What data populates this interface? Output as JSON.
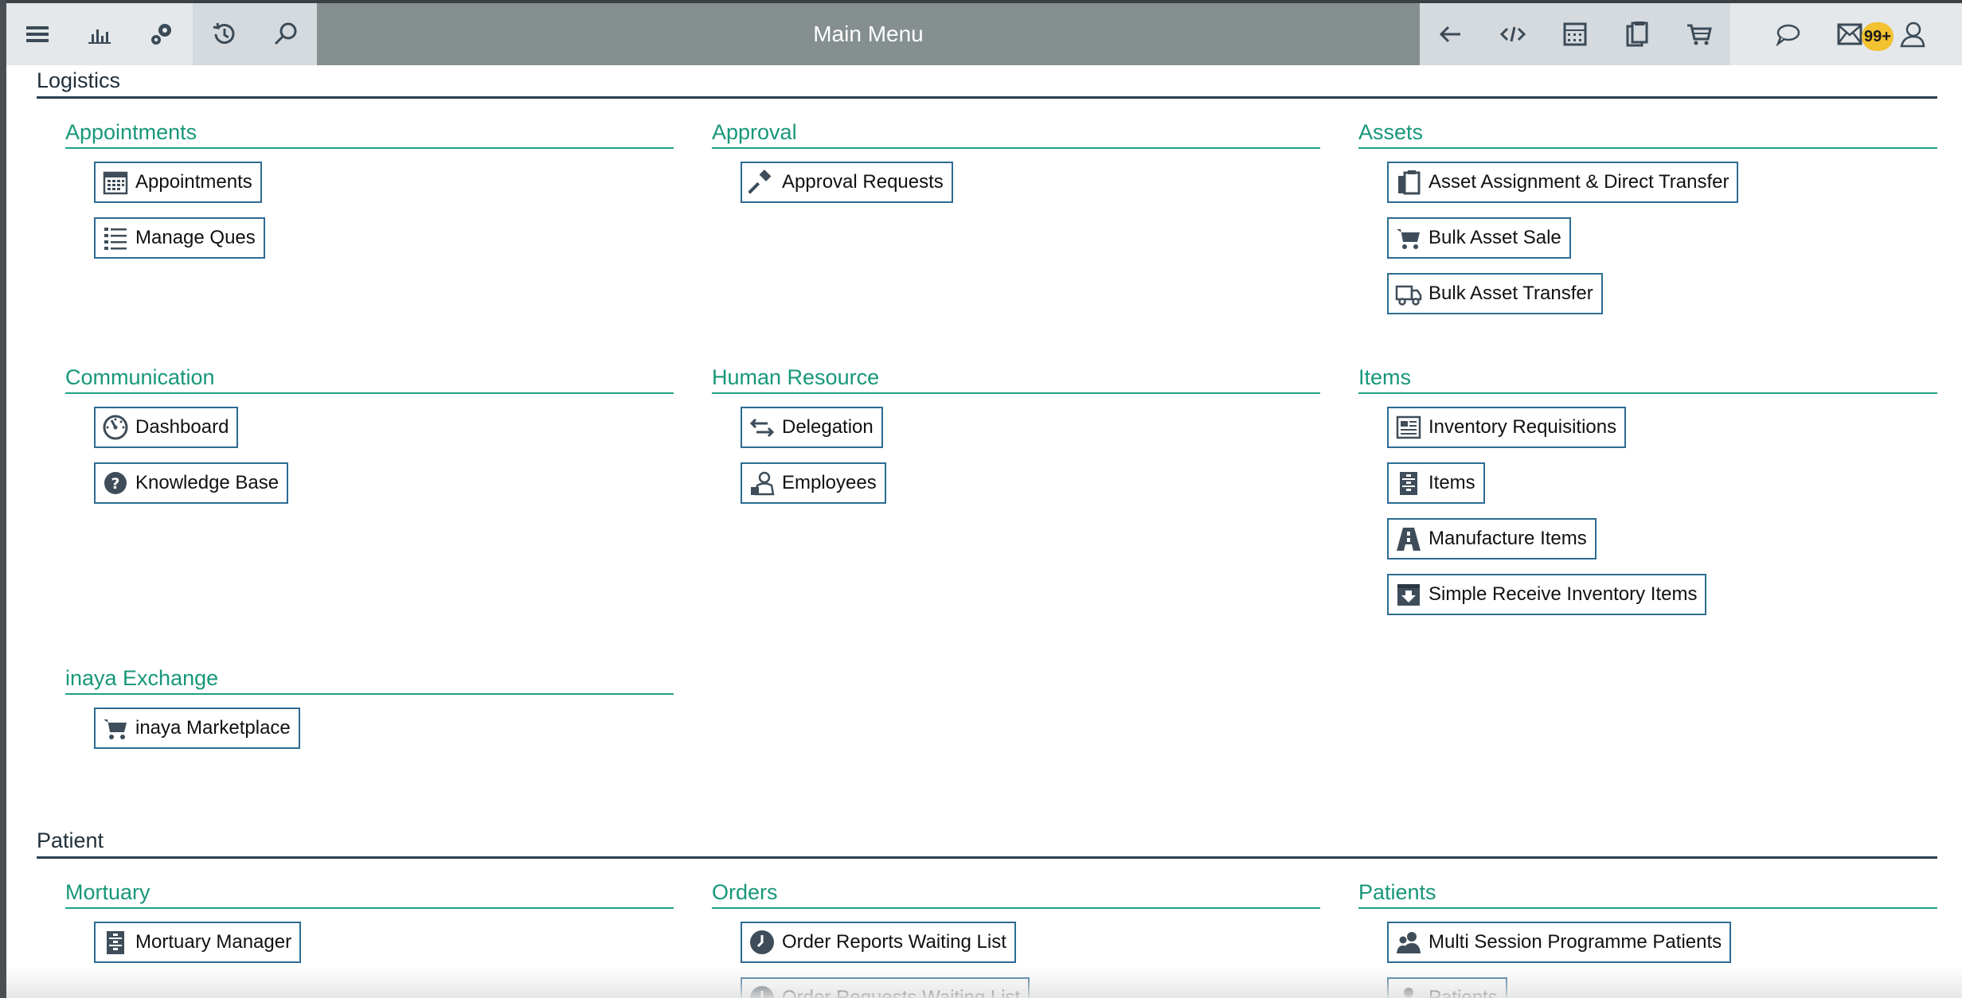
{
  "toolbar": {
    "title": "Main Menu",
    "badge": "99+",
    "left_icons": [
      "menu-icon",
      "bar-chart-icon",
      "gears-icon",
      "history-icon",
      "search-icon"
    ],
    "right_icons": [
      "back-arrow-icon",
      "code-icon",
      "calculator-icon",
      "clipboard-icon",
      "cart-icon"
    ],
    "far_right_icons": [
      "chat-icon",
      "mail-icon",
      "user-icon"
    ],
    "colors": {
      "title_bar": "#868f8f",
      "badge": "#f2c230",
      "icon": "#3b4a57"
    }
  },
  "sections": {
    "logistics": {
      "title": "Logistics",
      "groups": {
        "appointments": {
          "title": "Appointments",
          "items": [
            {
              "label": "Appointments",
              "icon": "calendar-icon"
            },
            {
              "label": "Manage Ques",
              "icon": "list-icon"
            }
          ]
        },
        "approval": {
          "title": "Approval",
          "items": [
            {
              "label": "Approval Requests",
              "icon": "gavel-icon"
            }
          ]
        },
        "assets": {
          "title": "Assets",
          "items": [
            {
              "label": "Asset Assignment & Direct Transfer",
              "icon": "clipboard-copy-icon"
            },
            {
              "label": "Bulk Asset Sale",
              "icon": "cart-icon"
            },
            {
              "label": "Bulk Asset Transfer",
              "icon": "truck-icon"
            }
          ]
        },
        "communication": {
          "title": "Communication",
          "items": [
            {
              "label": "Dashboard",
              "icon": "gauge-icon"
            },
            {
              "label": "Knowledge Base",
              "icon": "question-icon"
            }
          ]
        },
        "human_resource": {
          "title": "Human Resource",
          "items": [
            {
              "label": "Delegation",
              "icon": "swap-arrows-icon"
            },
            {
              "label": "Employees",
              "icon": "employee-icon"
            }
          ]
        },
        "items": {
          "title": "Items",
          "items": [
            {
              "label": "Inventory Requisitions",
              "icon": "document-icon"
            },
            {
              "label": "Items",
              "icon": "cabinet-icon"
            },
            {
              "label": "Manufacture Items",
              "icon": "road-icon"
            },
            {
              "label": "Simple Receive Inventory Items",
              "icon": "inbox-download-icon"
            }
          ]
        },
        "inaya_exchange": {
          "title": "inaya Exchange",
          "items": [
            {
              "label": "inaya Marketplace",
              "icon": "cart-icon"
            }
          ]
        }
      }
    },
    "patient": {
      "title": "Patient",
      "groups": {
        "mortuary": {
          "title": "Mortuary",
          "items": [
            {
              "label": "Mortuary Manager",
              "icon": "cabinet-icon"
            }
          ]
        },
        "orders": {
          "title": "Orders",
          "items": [
            {
              "label": "Order Reports Waiting List",
              "icon": "clock-icon"
            },
            {
              "label": "Order Requests Waiting List",
              "icon": "clock-icon"
            }
          ]
        },
        "patients": {
          "title": "Patients",
          "items": [
            {
              "label": "Multi Session Programme Patients",
              "icon": "patients-group-icon"
            },
            {
              "label": "Patients",
              "icon": "patient-icon"
            }
          ]
        }
      }
    }
  }
}
